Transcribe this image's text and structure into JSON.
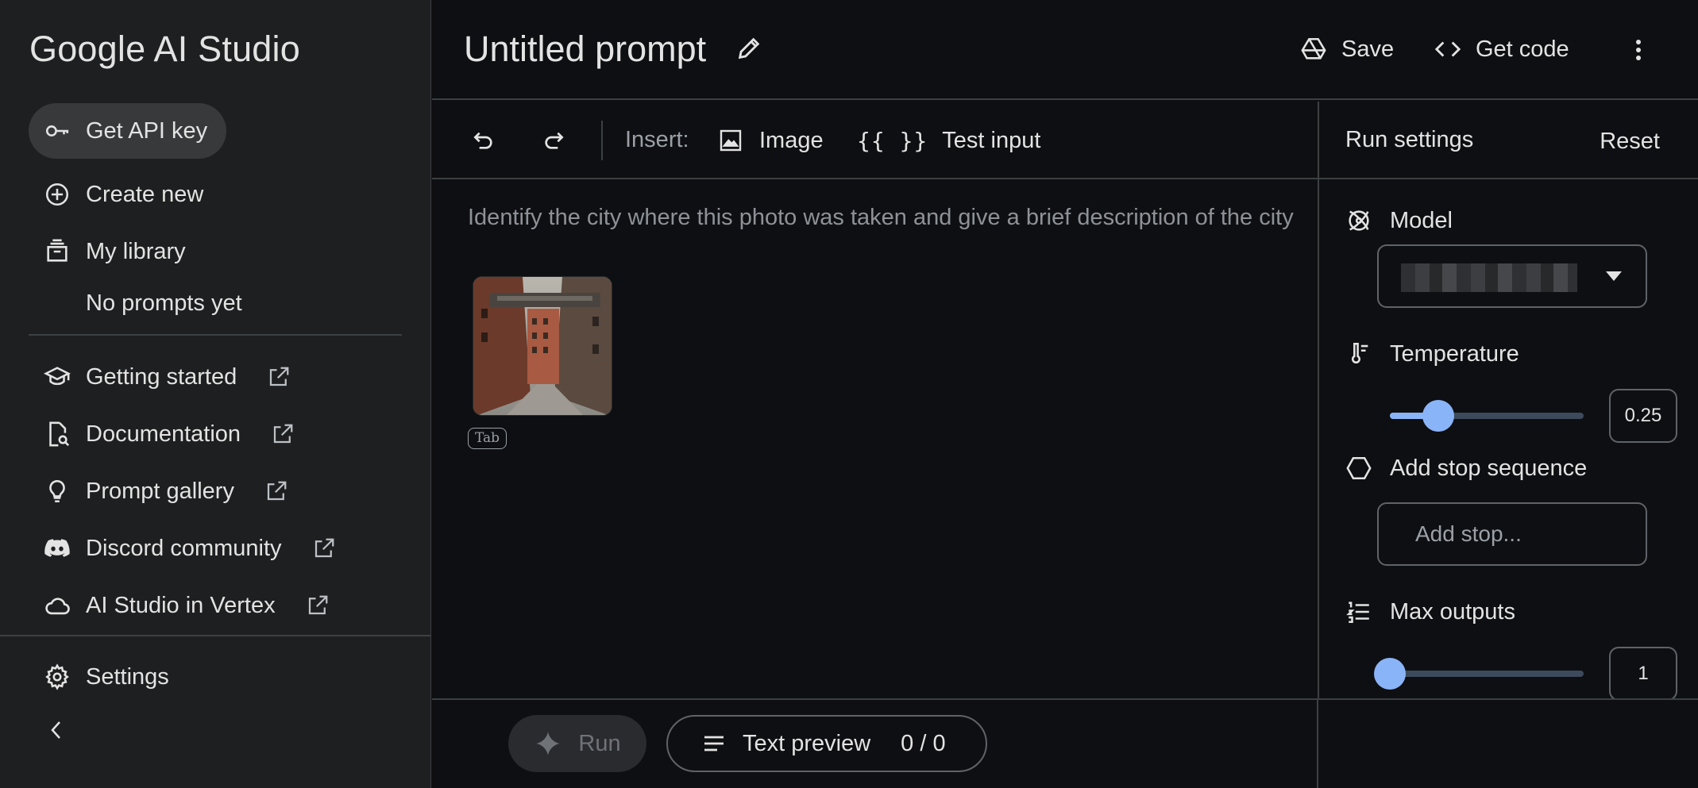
{
  "app": {
    "brand": "Google AI Studio"
  },
  "sidebar": {
    "api_key_label": "Get API key",
    "create_new_label": "Create new",
    "library_label": "My library",
    "library_empty": "No prompts yet",
    "links": [
      {
        "label": "Getting started",
        "icon": "school-icon"
      },
      {
        "label": "Documentation",
        "icon": "doc-search-icon"
      },
      {
        "label": "Prompt gallery",
        "icon": "lightbulb-icon"
      },
      {
        "label": "Discord community",
        "icon": "discord-icon"
      },
      {
        "label": "AI Studio in Vertex",
        "icon": "cloud-icon"
      }
    ],
    "settings_label": "Settings"
  },
  "header": {
    "title": "Untitled prompt",
    "save_label": "Save",
    "get_code_label": "Get code"
  },
  "toolbar": {
    "insert_label": "Insert:",
    "image_label": "Image",
    "braces": "{{ }}",
    "test_input_label": "Test input"
  },
  "editor": {
    "prompt_text": "Identify the city where this photo was taken and give a brief description of the city",
    "tab_hint": "Tab"
  },
  "run_settings": {
    "title": "Run settings",
    "reset_label": "Reset",
    "model_label": "Model",
    "temperature_label": "Temperature",
    "temperature_value": "0.25",
    "temperature_fraction": 0.25,
    "stop_label": "Add stop sequence",
    "stop_placeholder": "Add stop...",
    "max_outputs_label": "Max outputs",
    "max_outputs_value": "1",
    "max_outputs_fraction": 0.0
  },
  "footer": {
    "run_label": "Run",
    "preview_label": "Text preview",
    "preview_count": "0 / 0"
  },
  "colors": {
    "accent": "#8ab4f8",
    "background": "#0e0f12",
    "sidebar": "#1e1f20"
  }
}
